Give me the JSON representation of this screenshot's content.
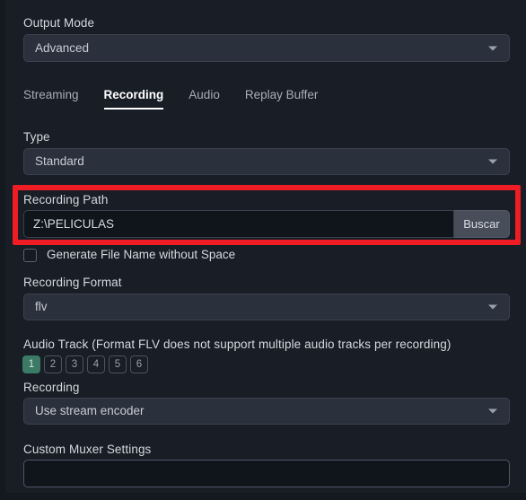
{
  "output_mode": {
    "label": "Output Mode",
    "value": "Advanced"
  },
  "tabs": [
    {
      "label": "Streaming",
      "active": false
    },
    {
      "label": "Recording",
      "active": true
    },
    {
      "label": "Audio",
      "active": false
    },
    {
      "label": "Replay Buffer",
      "active": false
    }
  ],
  "type": {
    "label": "Type",
    "value": "Standard"
  },
  "recording_path": {
    "label": "Recording Path",
    "value": "Z:\\PELICULAS",
    "browse_label": "Buscar"
  },
  "generate_file_name": {
    "label": "Generate File Name without Space",
    "checked": false
  },
  "recording_format": {
    "label": "Recording Format",
    "value": "flv"
  },
  "audio_track": {
    "label": "Audio Track (Format FLV does not support multiple audio tracks per recording)",
    "tracks": [
      {
        "label": "1",
        "selected": true
      },
      {
        "label": "2",
        "selected": false
      },
      {
        "label": "3",
        "selected": false
      },
      {
        "label": "4",
        "selected": false
      },
      {
        "label": "5",
        "selected": false
      },
      {
        "label": "6",
        "selected": false
      }
    ]
  },
  "recording_encoder": {
    "label": "Recording",
    "value": "Use stream encoder"
  },
  "custom_muxer": {
    "label": "Custom Muxer Settings",
    "value": "",
    "placeholder": ""
  },
  "annotation": {
    "type": "rectangle-highlight",
    "color": "#ee1d24",
    "target": "recording-path"
  },
  "theme": {
    "background": "#14181f",
    "panel": "#181d26",
    "input_background": "#10141b",
    "combo_background": "#2b313c",
    "accent_selected": "#3c7a65",
    "text_primary": "#d4d8de",
    "text_active_tab": "#ffffff"
  }
}
